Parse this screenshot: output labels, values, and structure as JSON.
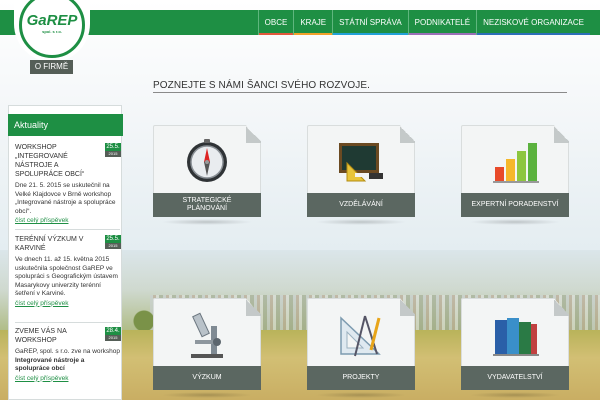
{
  "brand": {
    "logo_text": "GaREP",
    "logo_sub": "spol. s r.o."
  },
  "nav": [
    {
      "label": "OBCE",
      "color": "#e2583c"
    },
    {
      "label": "KRAJE",
      "color": "#f2a12b"
    },
    {
      "label": "STÁTNÍ SPRÁVA",
      "color": "#22a1d8"
    },
    {
      "label": "PODNIKATELÉ",
      "color": "#9b6fb8"
    },
    {
      "label": "NEZISKOVÉ ORGANIZACE",
      "color": "#2c6fb8"
    }
  ],
  "ofirme_label": "O FIRMĚ",
  "page_title": "POZNEJTE S NÁMI ŠANCI SVÉHO ROZVOJE.",
  "sidebar": {
    "title": "Aktuality",
    "news": [
      {
        "title": "WORKSHOP „INTEGROVANÉ NÁSTROJE A SPOLUPRÁCE OBCÍ“",
        "day": "25.5.",
        "year": "2015",
        "text": "Dne 21. 5. 2015 se uskutečnil na Velké Klajdovce v Brně workshop „Integrované nástroje a spolupráce obcí“.",
        "link": "číst celý příspěvek"
      },
      {
        "title": "TERÉNNÍ VÝZKUM V KARVINÉ",
        "day": "25.5.",
        "year": "2015",
        "text": "Ve dnech 11. až 15. května 2015 uskutečnila společnost GaREP ve spolupráci s Geografickým ústavem Masarykovy univerzity terénní šetření v Karviné.",
        "link": "číst celý příspěvek"
      },
      {
        "title": "ZVEME VÁS NA WORKSHOP",
        "day": "28.4.",
        "year": "2015",
        "text_pre": "GaREP, spol. s r.o. zve na workshop ",
        "text_bold": "Integrované nástroje a spolupráce obcí",
        "link": "číst celý příspěvek"
      }
    ]
  },
  "tiles": [
    {
      "label": "STRATEGICKÉ PLÁNOVÁNÍ",
      "icon": "compass-icon"
    },
    {
      "label": "VZDĚLÁVÁNÍ",
      "icon": "chalkboard-icon"
    },
    {
      "label": "EXPERTNÍ PORADENSTVÍ",
      "icon": "bar-chart-icon"
    },
    {
      "label": "VÝZKUM",
      "icon": "microscope-icon"
    },
    {
      "label": "PROJEKTY",
      "icon": "drafting-tools-icon"
    },
    {
      "label": "VYDAVATELSTVÍ",
      "icon": "books-icon"
    }
  ]
}
